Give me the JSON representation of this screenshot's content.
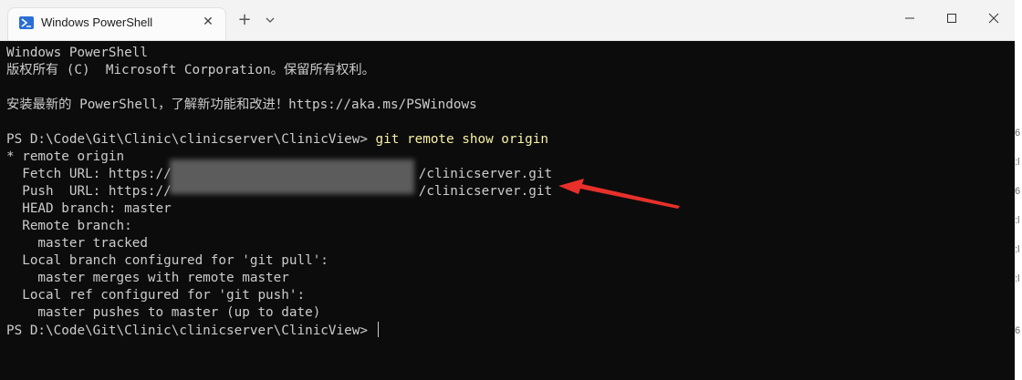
{
  "window": {
    "tab_title": "Windows PowerShell",
    "tab_close": "✕",
    "new_tab": "+"
  },
  "terminal": {
    "lines": [
      "Windows PowerShell",
      "版权所有 (C)  Microsoft Corporation。保留所有权利。",
      "",
      "安装最新的 PowerShell，了解新功能和改进！https://aka.ms/PSWindows",
      "",
      "PS D:\\Code\\Git\\Clinic\\clinicserver\\ClinicView>",
      "* remote origin",
      "  Fetch URL: https://",
      "  Push  URL: https://",
      "  HEAD branch: master",
      "  Remote branch:",
      "    master tracked",
      "  Local branch configured for 'git pull':",
      "    master merges with remote master",
      "  Local ref configured for 'git push':",
      "    master pushes to master (up to date)",
      "PS D:\\Code\\Git\\Clinic\\clinicserver\\ClinicView>"
    ],
    "command": " git remote show origin",
    "fetch_url_tail": "/clinicserver.git",
    "push_url_tail": "/clinicserver.git"
  },
  "colors": {
    "terminal_bg": "#0c0c0c",
    "terminal_text": "#cccccc",
    "command_text": "#f9f1a5",
    "annotation_arrow": "#e8302a"
  },
  "right_strip": [
    "6",
    ":l",
    "6",
    ":l",
    ":l",
    ":l",
    "6"
  ]
}
